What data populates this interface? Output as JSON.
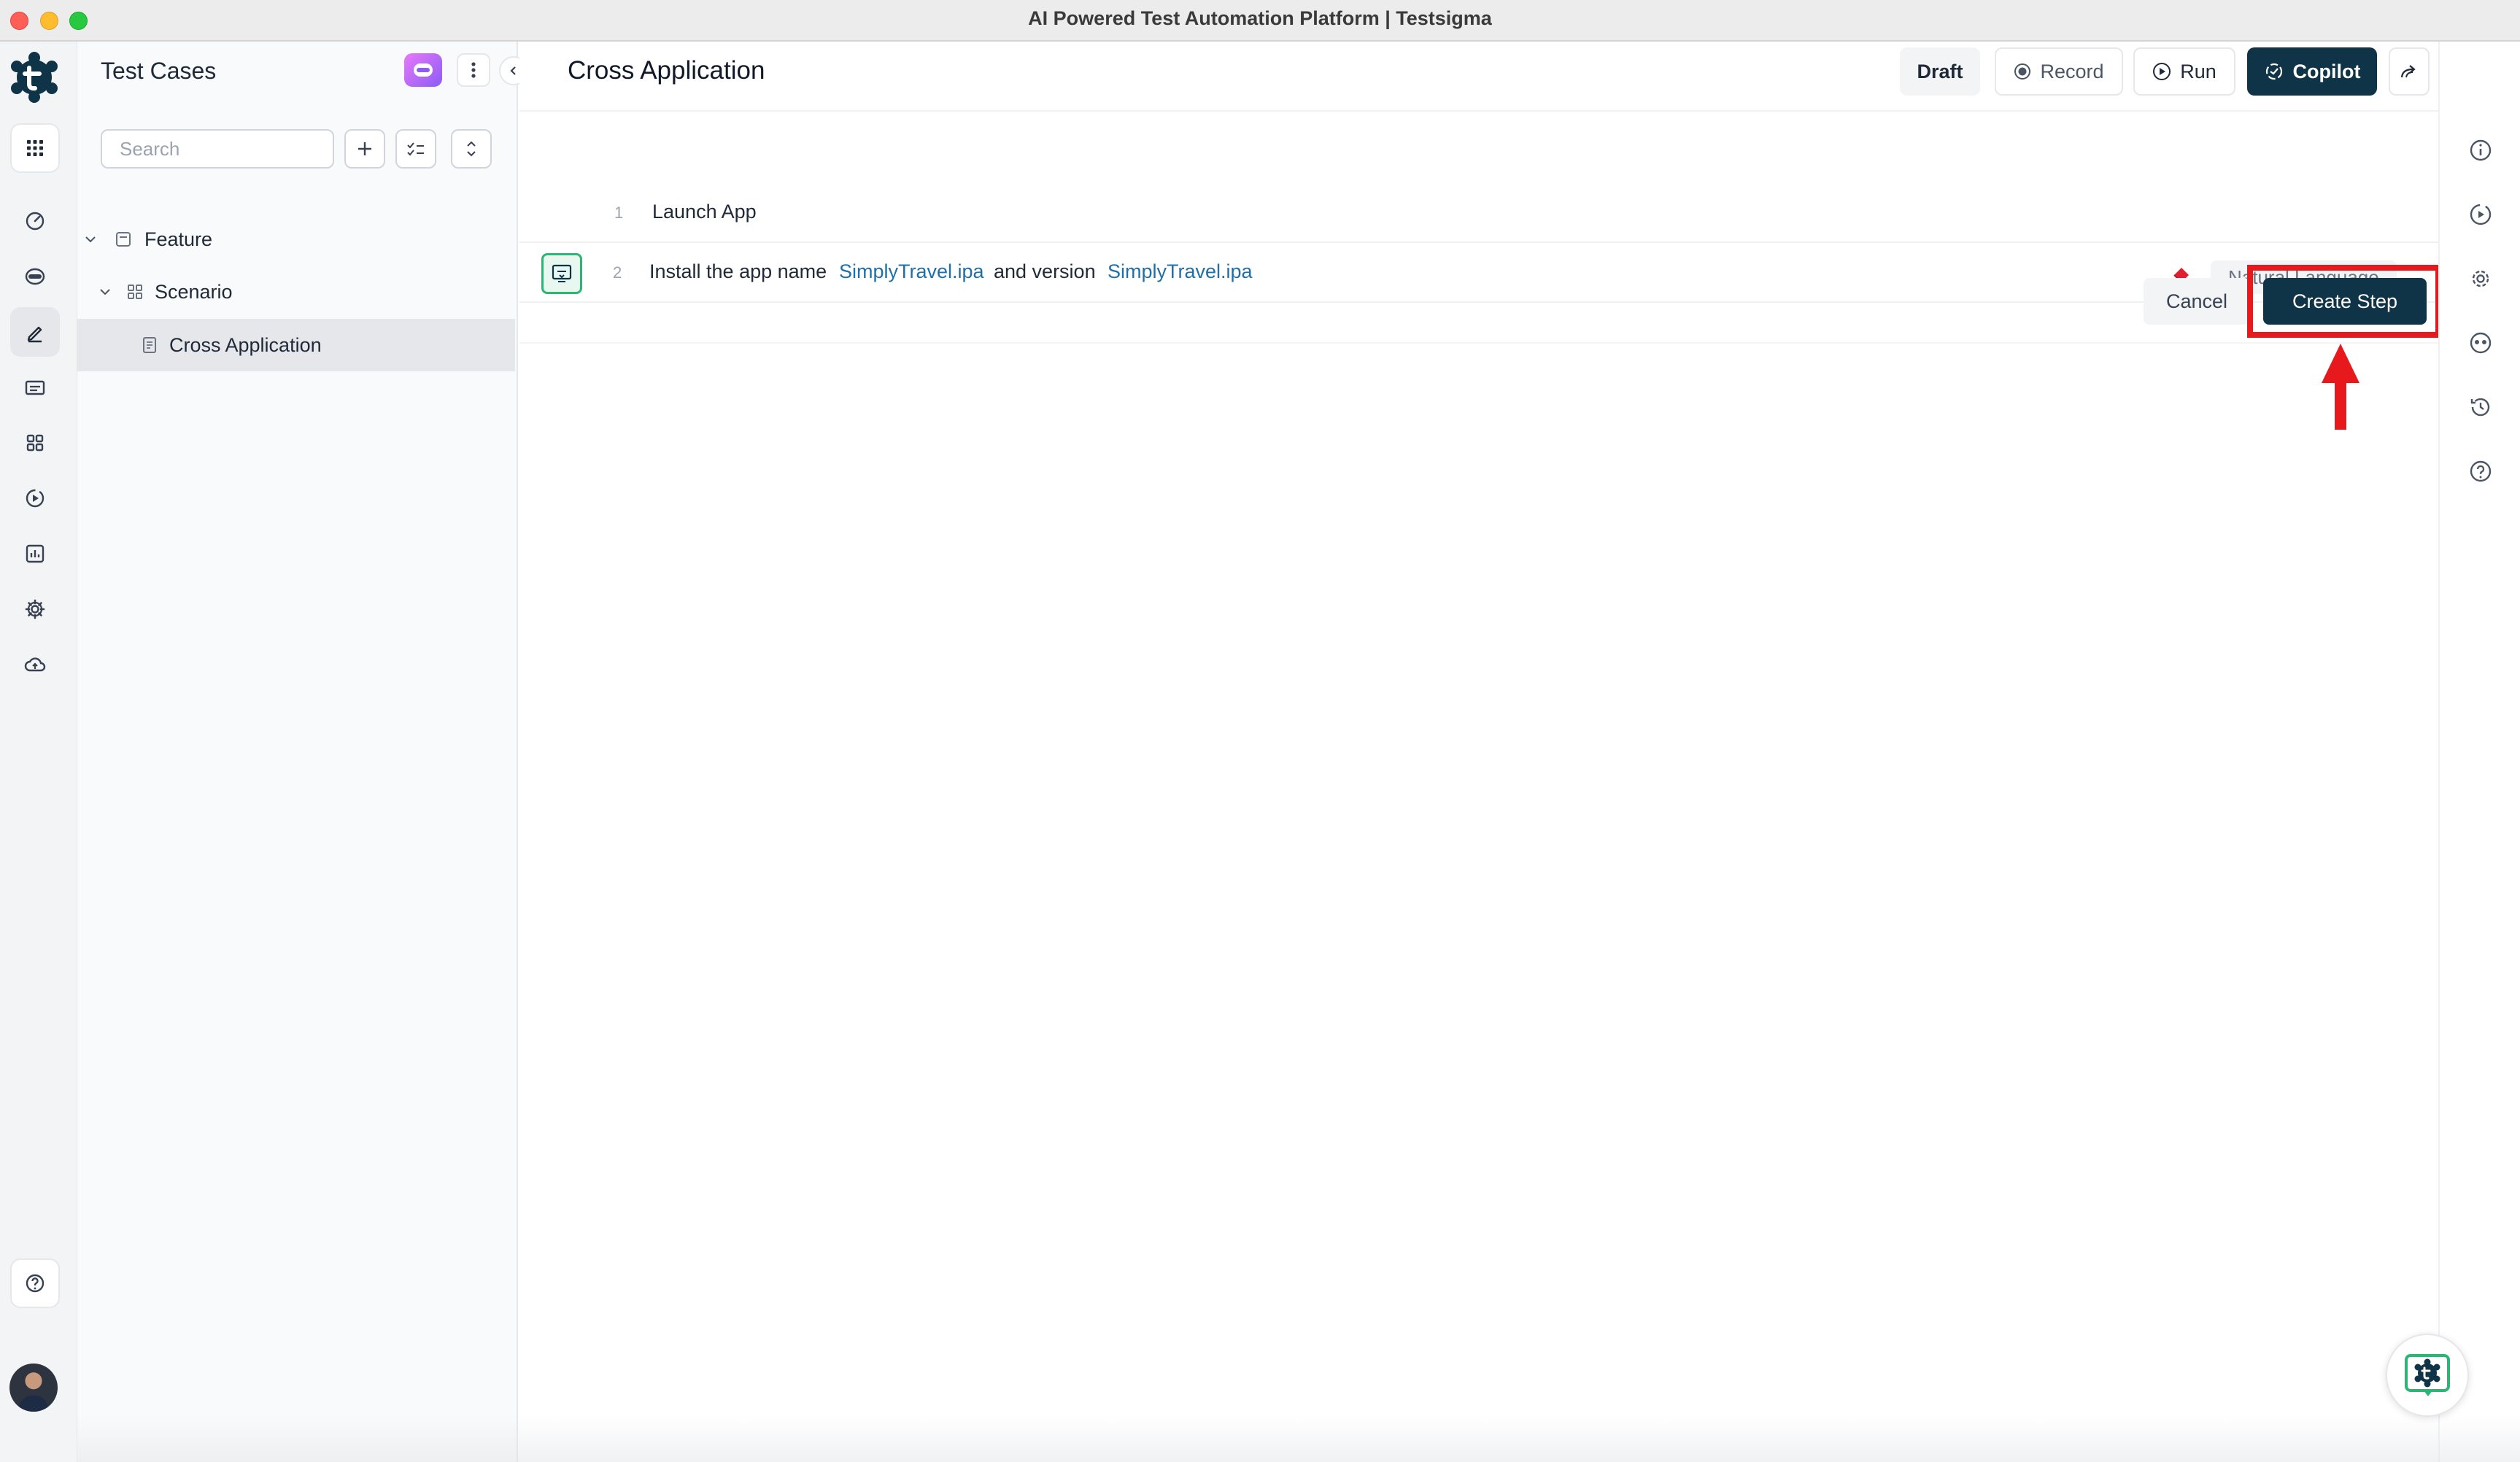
{
  "window": {
    "title": "AI Powered Test Automation Platform | Testsigma"
  },
  "rail": {
    "logo": "testsigma-logo-icon",
    "items": [
      {
        "icon": "apps-grid-icon"
      },
      {
        "icon": "dashboard-gauge-icon"
      },
      {
        "icon": "copilot-robot-icon"
      },
      {
        "icon": "pencil-edit-icon",
        "active": true
      },
      {
        "icon": "folder-icon"
      },
      {
        "icon": "blocks-grid-icon"
      },
      {
        "icon": "play-circle-icon"
      },
      {
        "icon": "reports-chart-icon"
      },
      {
        "icon": "settings-gear-icon"
      },
      {
        "icon": "cloud-upload-icon"
      },
      {
        "icon": "help-circle-icon"
      }
    ]
  },
  "panel": {
    "title": "Test Cases",
    "search_placeholder": "Search",
    "tree": [
      {
        "label": "Feature",
        "level": 0,
        "expanded": true
      },
      {
        "label": "Scenario",
        "level": 1,
        "expanded": true
      },
      {
        "label": "Cross Application",
        "level": 2,
        "selected": true
      }
    ]
  },
  "header": {
    "title": "Cross Application",
    "draft": "Draft",
    "record": "Record",
    "run": "Run",
    "copilot": "Copilot"
  },
  "steps": [
    {
      "num": "1",
      "text": "Launch App"
    },
    {
      "num": "2",
      "text_a": "Install the app name",
      "data_a": "SimplyTravel.ipa",
      "text_b": "and version",
      "data_b": "SimplyTravel.ipa",
      "mode": "Natural Language"
    }
  ],
  "actions": {
    "cancel": "Cancel",
    "create": "Create Step"
  },
  "colors": {
    "primary": "#0f3347",
    "link": "#1f6fa8",
    "highlight": "#e8191d",
    "accent_green": "#2bb673"
  }
}
